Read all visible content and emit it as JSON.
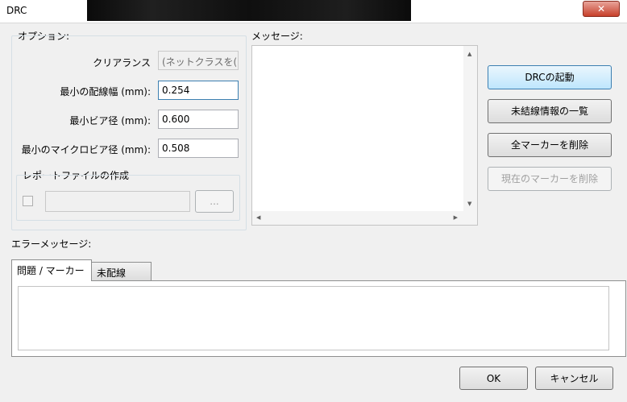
{
  "window": {
    "title": "DRC",
    "close_symbol": "✕"
  },
  "options": {
    "group_label": "オプション:",
    "clearance_label": "クリアランス",
    "clearance_value": "(ネットクラスを(",
    "min_track_width_label": "最小の配線幅 (mm):",
    "min_track_width_value": "0.254",
    "min_via_label": "最小ビア径 (mm):",
    "min_via_value": "0.600",
    "min_microvia_label": "最小のマイクロビア径 (mm):",
    "min_microvia_value": "0.508",
    "report_group_label": "レポートファイルの作成",
    "browse_label": "..."
  },
  "messages": {
    "label": "メッセージ:"
  },
  "actions": {
    "start_drc": "DRCの起動",
    "list_unconnected": "未結線情報の一覧",
    "delete_all_markers": "全マーカーを削除",
    "delete_current_marker": "現在のマーカーを削除"
  },
  "errors": {
    "label": "エラーメッセージ:",
    "tabs": [
      {
        "label": "問題 / マーカー"
      },
      {
        "label": "未配線"
      }
    ]
  },
  "footer": {
    "ok": "OK",
    "cancel": "キャンセル"
  },
  "icons": {
    "up": "▲",
    "down": "▼",
    "left": "◀",
    "right": "▶"
  }
}
